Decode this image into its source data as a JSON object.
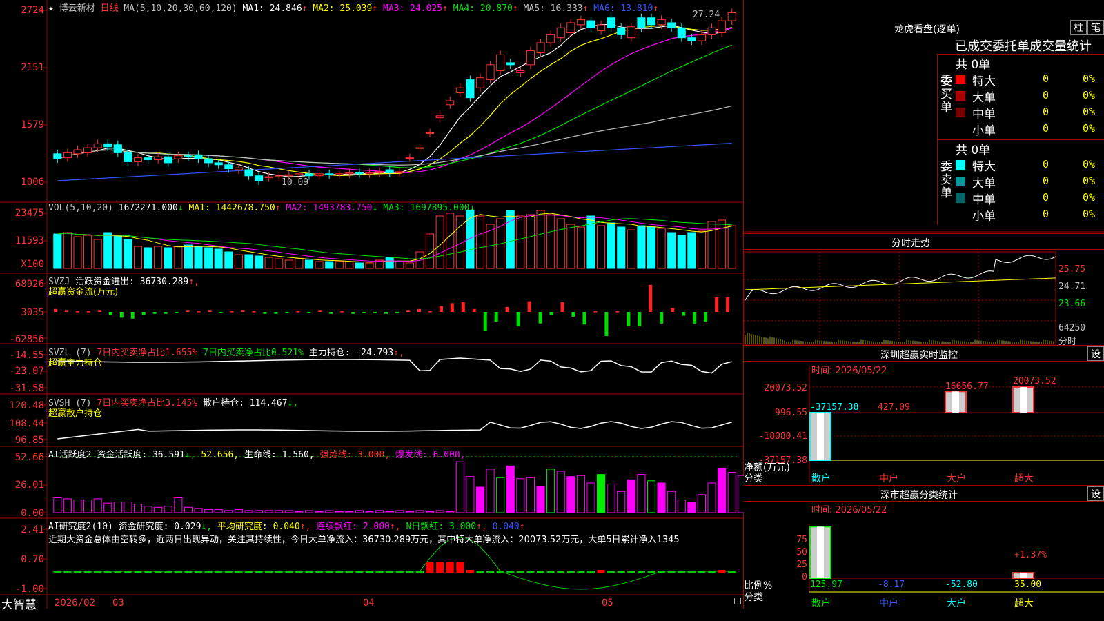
{
  "stock": {
    "star": "★",
    "name": "博云新材",
    "period": "日线",
    "ma_params": "MA(5,10,20,30,60,120)",
    "ma": [
      {
        "label": "MA1:",
        "value": "24.846",
        "arrow": "↑",
        "color": "#ffffff"
      },
      {
        "label": "MA2:",
        "value": "25.039",
        "arrow": "↑",
        "color": "#ffff00"
      },
      {
        "label": "MA3:",
        "value": "24.025",
        "arrow": "↑",
        "color": "#ff00ff"
      },
      {
        "label": "MA4:",
        "value": "20.870",
        "arrow": "↑",
        "color": "#00e000"
      },
      {
        "label": "MA5:",
        "value": "16.333",
        "arrow": "↑",
        "color": "#c0c0c0"
      },
      {
        "label": "MA6:",
        "value": "13.810",
        "arrow": "↑",
        "color": "#3355ff"
      }
    ],
    "high_marker": "27.24",
    "low_marker": "10.09",
    "price_axis": [
      "2724",
      "2151",
      "1579",
      "1006"
    ],
    "colors": {
      "up": "#ff3333",
      "down": "#00ffff",
      "ma1": "#ffffff",
      "ma2": "#ffff00",
      "ma3": "#ff00ff",
      "ma4": "#00e000",
      "ma5": "#c0c0c0",
      "ma6": "#3355ff"
    },
    "candles": [
      {
        "o": 12.9,
        "c": 12.4
      },
      {
        "o": 12.5,
        "c": 13.0
      },
      {
        "o": 12.9,
        "c": 13.3
      },
      {
        "o": 13.0,
        "c": 13.5
      },
      {
        "o": 13.5,
        "c": 13.9
      },
      {
        "o": 13.9,
        "c": 13.6
      },
      {
        "o": 13.8,
        "c": 13.0
      },
      {
        "o": 13.0,
        "c": 12.1
      },
      {
        "o": 12.1,
        "c": 12.5
      },
      {
        "o": 12.5,
        "c": 12.3
      },
      {
        "o": 12.3,
        "c": 12.6
      },
      {
        "o": 12.6,
        "c": 12.0
      },
      {
        "o": 12.4,
        "c": 12.7
      },
      {
        "o": 12.7,
        "c": 12.6
      },
      {
        "o": 12.8,
        "c": 12.4
      },
      {
        "o": 12.4,
        "c": 12.0
      },
      {
        "o": 12.0,
        "c": 11.8
      },
      {
        "o": 11.8,
        "c": 11.4
      },
      {
        "o": 11.3,
        "c": 11.5
      },
      {
        "o": 11.3,
        "c": 10.7
      },
      {
        "o": 10.7,
        "c": 10.2
      },
      {
        "o": 10.5,
        "c": 10.6
      },
      {
        "o": 10.6,
        "c": 10.7
      },
      {
        "o": 10.7,
        "c": 10.8
      },
      {
        "o": 10.8,
        "c": 10.9
      },
      {
        "o": 10.9,
        "c": 10.7
      },
      {
        "o": 10.7,
        "c": 10.9
      },
      {
        "o": 10.9,
        "c": 10.8
      },
      {
        "o": 10.8,
        "c": 10.9
      },
      {
        "o": 10.9,
        "c": 11.0
      },
      {
        "o": 11.0,
        "c": 10.9
      },
      {
        "o": 10.9,
        "c": 11.0
      },
      {
        "o": 11.0,
        "c": 11.1
      },
      {
        "o": 11.3,
        "c": 11.0
      },
      {
        "o": 11.0,
        "c": 11.1
      },
      {
        "o": 12.5,
        "c": 12.5
      },
      {
        "o": 13.5,
        "c": 13.5
      },
      {
        "o": 15.0,
        "c": 15.0
      },
      {
        "o": 16.5,
        "c": 16.7
      },
      {
        "o": 17.8,
        "c": 18.2
      },
      {
        "o": 19.0,
        "c": 19.5
      },
      {
        "o": 20.3,
        "c": 18.5
      },
      {
        "o": 19.5,
        "c": 20.5
      },
      {
        "o": 20.3,
        "c": 21.8
      },
      {
        "o": 21.2,
        "c": 22.8
      },
      {
        "o": 22.0,
        "c": 21.8
      },
      {
        "o": 21.0,
        "c": 21.2
      },
      {
        "o": 21.8,
        "c": 23.2
      },
      {
        "o": 23.0,
        "c": 24.0
      },
      {
        "o": 24.0,
        "c": 24.8
      },
      {
        "o": 24.5,
        "c": 25.5
      },
      {
        "o": 25.0,
        "c": 26.0
      },
      {
        "o": 25.8,
        "c": 26.3
      },
      {
        "o": 26.2,
        "c": 25.5
      },
      {
        "o": 25.2,
        "c": 25.8
      },
      {
        "o": 26.5,
        "c": 25.5
      },
      {
        "o": 25.5,
        "c": 24.8
      },
      {
        "o": 24.5,
        "c": 25.6
      },
      {
        "o": 26.5,
        "c": 25.5
      },
      {
        "o": 26.5,
        "c": 25.8
      },
      {
        "o": 25.8,
        "c": 26.3
      },
      {
        "o": 26.0,
        "c": 25.5
      },
      {
        "o": 25.5,
        "c": 24.5
      },
      {
        "o": 24.5,
        "c": 24.2
      },
      {
        "o": 24.2,
        "c": 24.8
      },
      {
        "o": 24.8,
        "c": 25.5
      },
      {
        "o": 25.0,
        "c": 26.2
      },
      {
        "o": 26.2,
        "c": 27.0
      }
    ]
  },
  "vol": {
    "label": "VOL(5,10,20)",
    "value": "1672271.000",
    "arrow": "↓",
    "ma": [
      {
        "label": "MA1:",
        "value": "1442678.750",
        "arrow": "↑",
        "color": "#ffff00"
      },
      {
        "label": "MA2:",
        "value": "1493783.750",
        "arrow": "↓",
        "color": "#ff00ff"
      },
      {
        "label": "MA3:",
        "value": "1697895.000",
        "arrow": "↓",
        "color": "#00e000"
      }
    ],
    "axis": [
      "23475",
      "11593",
      "X100"
    ],
    "bars": [
      2.5,
      2.6,
      2.3,
      2.4,
      2.1,
      2.6,
      2.4,
      2.1,
      1.6,
      1.5,
      1.6,
      1.5,
      1.6,
      1.7,
      1.6,
      1.5,
      1.4,
      1.2,
      1.0,
      1.0,
      0.9,
      0.8,
      0.7,
      0.6,
      0.7,
      0.6,
      0.5,
      0.5,
      0.5,
      0.5,
      0.4,
      0.4,
      0.6,
      0.8,
      0.5,
      0.4,
      1.2,
      2.5,
      3.8,
      4.0,
      3.8,
      4.2,
      3.8,
      3.2,
      3.6,
      4.2,
      3.8,
      3.9,
      4.2,
      3.9,
      3.6,
      3.2,
      3.0,
      3.8,
      3.1,
      3.3,
      3.0,
      2.8,
      3.1,
      3.0,
      2.9,
      2.6,
      2.4,
      2.6,
      2.7,
      3.4,
      3.5,
      3.1
    ]
  },
  "svzj": {
    "label": "SVZJ",
    "text": "活跃资金进出:",
    "value": "36730.289",
    "arrow": "↑,",
    "sub": "超赢资金流(万元)",
    "axis": [
      "68926",
      "3035",
      "-62856"
    ],
    "bars": [
      0.3,
      0.2,
      0.1,
      0.1,
      0.2,
      -0.3,
      -0.6,
      -0.7,
      -0.3,
      -0.2,
      -0.2,
      -0.1,
      0.2,
      0.1,
      0.2,
      -0.1,
      0.1,
      0.2,
      0.1,
      -0.2,
      -0.2,
      -0.1,
      0.1,
      -0.1,
      0.2,
      -0.2,
      0.1,
      -0.2,
      -0.1,
      -0.1,
      -0.2,
      -0.1,
      0.2,
      0.3,
      0.1,
      0.6,
      0.9,
      1.0,
      0.3,
      -2.0,
      -1.0,
      0.5,
      -1.5,
      1.1,
      -1.2,
      -0.3,
      1.0,
      -0.5,
      -1.3,
      0.1,
      -2.5,
      0.1,
      -1.5,
      -1.5,
      2.8,
      -1.2,
      0.4,
      -0.4,
      -1.2,
      -1.0,
      1.5,
      1.5
    ]
  },
  "svzl": {
    "label": "SVZL (7)",
    "t1": "7日内买卖净占比1.655%",
    "t2": "7日内买卖净占比0.521%",
    "t3": "主力持仓:",
    "value": "-24.793",
    "arrow": "↑,",
    "sub": "超赢主力持仓",
    "axis": [
      "-14.55",
      "-23.07",
      "-31.58"
    ]
  },
  "svsh": {
    "label": "SVSH (7)",
    "t1": "7日内买卖净占比3.145%",
    "t2": "散户持仓:",
    "value": "114.467",
    "arrow": "↓,",
    "sub": "超赢散户持仓",
    "axis": [
      "120.48",
      "108.44",
      "96.85"
    ]
  },
  "ai1": {
    "label": "AI活跃度2",
    "t1": "资金活跃度:",
    "v1": "36.591",
    "a1": "↓,",
    "v2": "52.656,",
    "t3": "生命线:",
    "v3": "1.560,",
    "t4": "强势线:",
    "v4": "3.000,",
    "t5": "爆发线:",
    "v5": "6.000,",
    "axis": [
      "52.66",
      "26.01",
      "0.00"
    ],
    "bars": [
      14,
      13,
      12,
      12,
      13,
      9,
      10,
      10,
      8,
      6,
      5,
      6,
      14,
      5,
      4,
      3,
      3,
      2,
      3,
      2,
      2,
      2,
      2,
      2,
      1,
      2,
      1,
      2,
      1,
      1,
      2,
      1,
      2,
      1,
      2,
      1,
      2,
      1,
      2,
      1,
      48,
      34,
      24,
      41,
      33,
      44,
      32,
      33,
      25,
      41,
      39,
      34,
      35,
      28,
      36,
      27,
      20,
      31,
      36,
      30,
      28,
      20,
      12,
      10,
      17,
      28,
      42,
      38,
      35
    ]
  },
  "ai2": {
    "label": "AI研究度2(10)",
    "t1": "资金研究度:",
    "v1": "0.029",
    "a1": "↓,",
    "t2": "平均研究度:",
    "v2": "0.040",
    "a2": "↑,",
    "t3": "连续飘红:",
    "v3": "2.000",
    "a3": "↑,",
    "t4": "N日飘红:",
    "v4": "3.000",
    "a4": "↑,",
    "v5": "0.040",
    "a5": "↑",
    "comment": "近期大资金总体由空转多，近两日出现异动，关注其持续性，今日大单净流入：36730.289万元，其中特大单净流入：20073.52万元，大单5日累计净入1345",
    "axis": [
      "2.41",
      "0.70",
      "-1.00"
    ]
  },
  "x_axis": {
    "logo": "大智慧",
    "labels": [
      "2026/02",
      "03",
      "04",
      "05"
    ]
  },
  "right": {
    "title": "龙虎看盘(逐单)",
    "btn1": "柱",
    "btn2": "笔",
    "section_title": "已成交委托单成交量统计",
    "buy": {
      "side_label": "委买单",
      "total": "共 0单",
      "rows": [
        {
          "name": "特大",
          "count": "0",
          "pct": "0%",
          "color": "#ff0000"
        },
        {
          "name": "大单",
          "count": "0",
          "pct": "0%",
          "color": "#aa0000"
        },
        {
          "name": "中单",
          "count": "0",
          "pct": "0%",
          "color": "#770000"
        },
        {
          "name": "小单",
          "count": "0",
          "pct": "0%",
          "color": "#000000"
        }
      ]
    },
    "sell": {
      "side_label": "委卖单",
      "total": "共 0单",
      "rows": [
        {
          "name": "特大",
          "count": "0",
          "pct": "0%",
          "color": "#00ffff"
        },
        {
          "name": "大单",
          "count": "0",
          "pct": "0%",
          "color": "#009999"
        },
        {
          "name": "中单",
          "count": "0",
          "pct": "0%",
          "color": "#006666"
        },
        {
          "name": "小单",
          "count": "0",
          "pct": "0%",
          "color": "#000000"
        }
      ]
    },
    "intraday": {
      "title": "分时走势",
      "axis": [
        "25.75",
        "24.71",
        "23.66"
      ],
      "vol_axis": "64250",
      "vol_label": "分时"
    },
    "sz_monitor": {
      "title": "深圳超赢实时监控",
      "btn": "设",
      "time": "时间: 2026/05/22",
      "axis": [
        "20073.52",
        "996.55",
        "-18080.41",
        "-37157.38"
      ],
      "values": [
        {
          "cat": "散户",
          "value": "-37157.38"
        },
        {
          "cat": "中户",
          "value": "427.09"
        },
        {
          "cat": "大户",
          "value": "16656.77"
        },
        {
          "cat": "超大",
          "value": "20073.52"
        }
      ],
      "ylabel": "净额(万元)",
      "xlabel": "分类"
    },
    "sz_class": {
      "title": "深市超赢分类统计",
      "btn": "设",
      "time": "时间: 2026/05/22",
      "axis": [
        "75",
        "50",
        "25",
        "0"
      ],
      "values": [
        {
          "cat": "散户",
          "value": "125.97"
        },
        {
          "cat": "中户",
          "value": "-8.17"
        },
        {
          "cat": "大户",
          "value": "-52.80"
        },
        {
          "cat": "超大",
          "value": "35.00"
        }
      ],
      "annotation": "+1.37%",
      "ylabel": "比例%",
      "xlabel": "分类"
    }
  },
  "chart_data": [
    {
      "type": "bar",
      "title": "深圳超赢实时监控",
      "categories": [
        "散户",
        "中户",
        "大户",
        "超大"
      ],
      "values": [
        -37157.38,
        427.09,
        16656.77,
        20073.52
      ],
      "ylabel": "净额(万元)",
      "xlabel": "分类",
      "ylim": [
        -37157.38,
        20073.52
      ]
    },
    {
      "type": "bar",
      "title": "深市超赢分类统计",
      "categories": [
        "散户",
        "中户",
        "大户",
        "超大"
      ],
      "values": [
        125.97,
        -8.17,
        -52.8,
        35.0
      ],
      "ylabel": "比例%",
      "xlabel": "分类",
      "ylim": [
        0,
        75
      ]
    }
  ]
}
